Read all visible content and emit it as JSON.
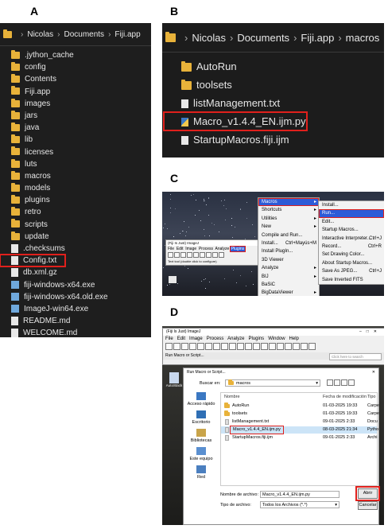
{
  "panels": {
    "a": "A",
    "b": "B",
    "c": "C",
    "d": "D"
  },
  "panel_a": {
    "breadcrumb": [
      "Nicolas",
      "Documents",
      "Fiji.app"
    ],
    "items": [
      {
        "label": ".jython_cache",
        "icon": "folder"
      },
      {
        "label": "config",
        "icon": "folder"
      },
      {
        "label": "Contents",
        "icon": "folder"
      },
      {
        "label": "Fiji.app",
        "icon": "folder"
      },
      {
        "label": "images",
        "icon": "folder"
      },
      {
        "label": "jars",
        "icon": "folder"
      },
      {
        "label": "java",
        "icon": "folder"
      },
      {
        "label": "lib",
        "icon": "folder"
      },
      {
        "label": "licenses",
        "icon": "folder"
      },
      {
        "label": "luts",
        "icon": "folder"
      },
      {
        "label": "macros",
        "icon": "folder"
      },
      {
        "label": "models",
        "icon": "folder"
      },
      {
        "label": "plugins",
        "icon": "folder"
      },
      {
        "label": "retro",
        "icon": "folder"
      },
      {
        "label": "scripts",
        "icon": "folder"
      },
      {
        "label": "update",
        "icon": "folder"
      },
      {
        "label": ".checksums",
        "icon": "file"
      },
      {
        "label": "Config.txt",
        "icon": "file",
        "highlighted": true
      },
      {
        "label": "db.xml.gz",
        "icon": "file"
      },
      {
        "label": "fiji-windows-x64.exe",
        "icon": "exe"
      },
      {
        "label": "fiji-windows-x64.old.exe",
        "icon": "exe"
      },
      {
        "label": "ImageJ-win64.exe",
        "icon": "exe"
      },
      {
        "label": "README.md",
        "icon": "file"
      },
      {
        "label": "WELCOME.md",
        "icon": "file"
      }
    ]
  },
  "panel_b": {
    "breadcrumb": [
      "Nicolas",
      "Documents",
      "Fiji.app",
      "macros"
    ],
    "items": [
      {
        "label": "AutoRun",
        "icon": "folder"
      },
      {
        "label": "toolsets",
        "icon": "folder"
      },
      {
        "label": "listManagement.txt",
        "icon": "file"
      },
      {
        "label": "Macro_v1.4.4_EN.ijm.py",
        "icon": "python-file",
        "highlighted": true
      },
      {
        "label": "StartupMacros.fiji.ijm",
        "icon": "file"
      }
    ]
  },
  "panel_c": {
    "imagej_title": "(Fiji Is Just) ImageJ",
    "imagej_menu": [
      "File",
      "Edit",
      "Image",
      "Process",
      "Analyze",
      "Plugins"
    ],
    "imagej_status": "Text tool (double click to configure)",
    "plugins_menu": [
      {
        "label": "Macros",
        "selected": true,
        "arrow": "▸"
      },
      {
        "label": "Shortcuts",
        "arrow": "▸"
      },
      {
        "label": "Utilities",
        "arrow": "▸"
      },
      {
        "label": "New",
        "arrow": "▸"
      },
      {
        "label": "Compile and Run..."
      },
      {
        "label": "Install...",
        "shortcut": "Ctrl+Mayús+M"
      },
      {
        "label": "Install PlugIn..."
      },
      {
        "label": "3D Viewer"
      },
      {
        "label": "Analyze",
        "arrow": "▸"
      },
      {
        "label": "BIJ",
        "arrow": "▸"
      },
      {
        "label": "BaSiC"
      },
      {
        "label": "BigDataViewer",
        "arrow": "▸"
      },
      {
        "label": "Bio-Formats",
        "arrow": "▸"
      }
    ],
    "macros_menu": [
      {
        "label": "Install..."
      },
      {
        "label": "Run...",
        "selected": true
      },
      {
        "label": "Edit..."
      },
      {
        "label": "Startup Macros..."
      },
      {
        "label": "Interactive Interpreter...",
        "shortcut": "Ctrl+J"
      },
      {
        "label": "Record...",
        "shortcut": "Ctrl+R"
      },
      {
        "label": "Set Drawing Color..."
      },
      {
        "label": "About Startup Macros..."
      },
      {
        "label": "Save As JPEG...",
        "shortcut": "Ctrl+J"
      },
      {
        "label": "Save Inverted FITS"
      }
    ]
  },
  "panel_d": {
    "imagej_title": "(Fiji Is Just) ImageJ",
    "imagej_menu": [
      "File",
      "Edit",
      "Image",
      "Process",
      "Analyze",
      "Plugins",
      "Window",
      "Help"
    ],
    "imagej_status": "Run Macro or Script...",
    "search_placeholder": "Click here to search",
    "dialog_title": "Run Macro or Script...",
    "look_in_label": "Buscar en:",
    "look_in_value": "macros",
    "nav": [
      "Acceso rápido",
      "Escritorio",
      "Bibliotecas",
      "Este equipo",
      "Red"
    ],
    "columns": [
      "Nombre",
      "Fecha de modificación",
      "Tipo"
    ],
    "rows": [
      {
        "name": "AutoRun",
        "date": "01-03-2025 19:33",
        "type": "Carpe"
      },
      {
        "name": "toolsets",
        "date": "01-03-2025 19:33",
        "type": "Carpe"
      },
      {
        "name": "listManagement.txt",
        "date": "09-01-2025 2:33",
        "type": "Docu"
      },
      {
        "name": "Macro_v1.4.4_EN.ijm.py",
        "date": "08-03-2025 21:34",
        "type": "Pytho",
        "highlighted": true
      },
      {
        "name": "StartupMacros.fiji.ijm",
        "date": "09-01-2025 2:33",
        "type": "Archi"
      }
    ],
    "filename_label": "Nombre de archivo:",
    "filename_value": "Macro_v1.4.4_EN.ijm.py",
    "filetype_label": "Tipo de archivo:",
    "filetype_value": "Todos los Archivos (*.*)",
    "open_button": "Abrir",
    "cancel_button": "Cancelar",
    "desktop_icon_label": "AutoStack"
  },
  "colors": {
    "highlight": "#e0201c",
    "selection": "#2d5bd7",
    "folder": "#e8b23a"
  }
}
